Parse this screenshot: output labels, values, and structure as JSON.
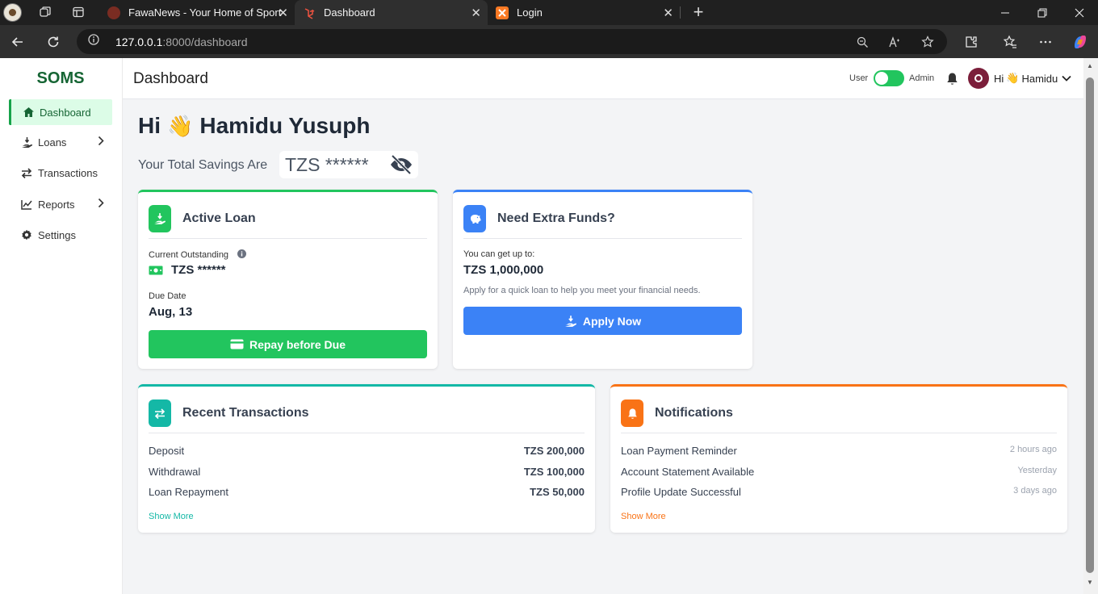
{
  "browser": {
    "tabs": [
      {
        "label": "FawaNews - Your Home of Sport",
        "active": false
      },
      {
        "label": "Dashboard",
        "active": true
      },
      {
        "label": "Login",
        "active": false
      }
    ],
    "url_host": "127.0.0.1",
    "url_path": ":8000/dashboard",
    "tab_close_glyph": "✕",
    "new_tab_glyph": "+"
  },
  "sidebar": {
    "brand": "SOMS",
    "items": [
      {
        "label": "Dashboard",
        "icon": "home-icon",
        "active": true
      },
      {
        "label": "Loans",
        "icon": "hand-coin-icon",
        "has_submenu": true
      },
      {
        "label": "Transactions",
        "icon": "exchange-icon"
      },
      {
        "label": "Reports",
        "icon": "chart-line-icon",
        "has_submenu": true
      },
      {
        "label": "Settings",
        "icon": "gear-icon"
      }
    ]
  },
  "topbar": {
    "title": "Dashboard",
    "mode_user": "User",
    "mode_admin": "Admin",
    "toggle_on": true,
    "greet_prefix": "Hi",
    "wave": "👋",
    "username": "Hamidu"
  },
  "hero": {
    "greet": "Hi",
    "wave": "👋",
    "name": "Hamidu Yusuph",
    "savings_label": "Your Total Savings Are",
    "savings_value": "TZS ******"
  },
  "active_loan": {
    "title": "Active Loan",
    "outstanding_label": "Current Outstanding",
    "outstanding_value": "TZS ******",
    "due_label": "Due Date",
    "due_value": "Aug, 13",
    "button": "Repay before Due"
  },
  "extra_funds": {
    "title": "Need Extra Funds?",
    "upto_label": "You can get up to:",
    "upto_value": "TZS 1,000,000",
    "description": "Apply for a quick loan to help you meet your financial needs.",
    "button": "Apply Now"
  },
  "transactions": {
    "title": "Recent Transactions",
    "rows": [
      {
        "label": "Deposit",
        "amount": "TZS 200,000"
      },
      {
        "label": "Withdrawal",
        "amount": "TZS 100,000"
      },
      {
        "label": "Loan Repayment",
        "amount": "TZS 50,000"
      }
    ],
    "show_more": "Show More"
  },
  "notifications": {
    "title": "Notifications",
    "rows": [
      {
        "label": "Loan Payment Reminder",
        "time": "2 hours ago"
      },
      {
        "label": "Account Statement Available",
        "time": "Yesterday"
      },
      {
        "label": "Profile Update Successful",
        "time": "3 days ago"
      }
    ],
    "show_more": "Show More"
  },
  "colors": {
    "green": "#22c55e",
    "blue": "#3b82f6",
    "teal": "#14b8a6",
    "orange": "#f97316",
    "brand_green": "#166534"
  }
}
